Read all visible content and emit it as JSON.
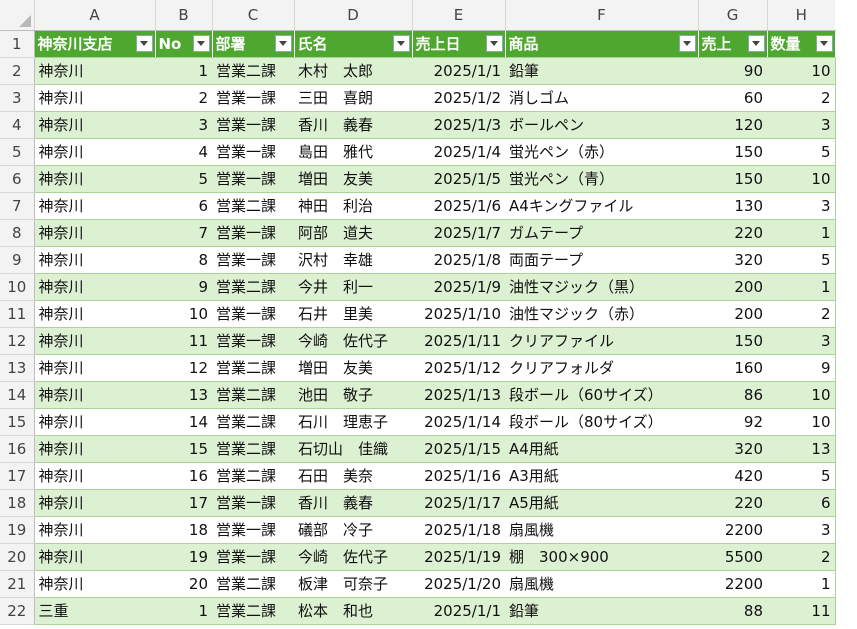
{
  "columns": [
    "A",
    "B",
    "C",
    "D",
    "E",
    "F",
    "G",
    "H"
  ],
  "headers": [
    "神奈川支店",
    "No",
    "部署",
    "氏名",
    "売上日",
    "商品",
    "売上",
    "数量"
  ],
  "rows": [
    {
      "n": "2",
      "v": [
        "神奈川",
        "1",
        "営業二課",
        "木村　太郎",
        "2025/1/1",
        "鉛筆",
        "90",
        "10"
      ]
    },
    {
      "n": "3",
      "v": [
        "神奈川",
        "2",
        "営業一課",
        "三田　喜朗",
        "2025/1/2",
        "消しゴム",
        "60",
        "2"
      ]
    },
    {
      "n": "4",
      "v": [
        "神奈川",
        "3",
        "営業一課",
        "香川　義春",
        "2025/1/3",
        "ボールペン",
        "120",
        "3"
      ]
    },
    {
      "n": "5",
      "v": [
        "神奈川",
        "4",
        "営業一課",
        "島田　雅代",
        "2025/1/4",
        "蛍光ペン（赤）",
        "150",
        "5"
      ]
    },
    {
      "n": "6",
      "v": [
        "神奈川",
        "5",
        "営業一課",
        "増田　友美",
        "2025/1/5",
        "蛍光ペン（青）",
        "150",
        "10"
      ]
    },
    {
      "n": "7",
      "v": [
        "神奈川",
        "6",
        "営業二課",
        "神田　利治",
        "2025/1/6",
        "A4キングファイル",
        "130",
        "3"
      ]
    },
    {
      "n": "8",
      "v": [
        "神奈川",
        "7",
        "営業一課",
        "阿部　道夫",
        "2025/1/7",
        "ガムテープ",
        "220",
        "1"
      ]
    },
    {
      "n": "9",
      "v": [
        "神奈川",
        "8",
        "営業一課",
        "沢村　幸雄",
        "2025/1/8",
        "両面テープ",
        "320",
        "5"
      ]
    },
    {
      "n": "10",
      "v": [
        "神奈川",
        "9",
        "営業二課",
        "今井　利一",
        "2025/1/9",
        "油性マジック（黒）",
        "200",
        "1"
      ]
    },
    {
      "n": "11",
      "v": [
        "神奈川",
        "10",
        "営業一課",
        "石井　里美",
        "2025/1/10",
        "油性マジック（赤）",
        "200",
        "2"
      ]
    },
    {
      "n": "12",
      "v": [
        "神奈川",
        "11",
        "営業一課",
        "今崎　佐代子",
        "2025/1/11",
        "クリアファイル",
        "150",
        "3"
      ]
    },
    {
      "n": "13",
      "v": [
        "神奈川",
        "12",
        "営業二課",
        "増田　友美",
        "2025/1/12",
        "クリアフォルダ",
        "160",
        "9"
      ]
    },
    {
      "n": "14",
      "v": [
        "神奈川",
        "13",
        "営業二課",
        "池田　敬子",
        "2025/1/13",
        "段ボール（60サイズ）",
        "86",
        "10"
      ]
    },
    {
      "n": "15",
      "v": [
        "神奈川",
        "14",
        "営業二課",
        "石川　理恵子",
        "2025/1/14",
        "段ボール（80サイズ）",
        "92",
        "10"
      ]
    },
    {
      "n": "16",
      "v": [
        "神奈川",
        "15",
        "営業二課",
        "石切山　佳織",
        "2025/1/15",
        "A4用紙",
        "320",
        "13"
      ]
    },
    {
      "n": "17",
      "v": [
        "神奈川",
        "16",
        "営業二課",
        "石田　美奈",
        "2025/1/16",
        "A3用紙",
        "420",
        "5"
      ]
    },
    {
      "n": "18",
      "v": [
        "神奈川",
        "17",
        "営業一課",
        "香川　義春",
        "2025/1/17",
        "A5用紙",
        "220",
        "6"
      ]
    },
    {
      "n": "19",
      "v": [
        "神奈川",
        "18",
        "営業一課",
        "礒部　冷子",
        "2025/1/18",
        "扇風機",
        "2200",
        "3"
      ]
    },
    {
      "n": "20",
      "v": [
        "神奈川",
        "19",
        "営業一課",
        "今崎　佐代子",
        "2025/1/19",
        "棚　300×900",
        "5500",
        "2"
      ]
    },
    {
      "n": "21",
      "v": [
        "神奈川",
        "20",
        "営業二課",
        "板津　可奈子",
        "2025/1/20",
        "扇風機",
        "2200",
        "1"
      ]
    },
    {
      "n": "22",
      "v": [
        "三重",
        "1",
        "営業二課",
        "松本　和也",
        "2025/1/1",
        "鉛筆",
        "88",
        "11"
      ]
    }
  ],
  "colors": {
    "header_green": "#4ea72e",
    "band_green": "#dcf0d2"
  }
}
